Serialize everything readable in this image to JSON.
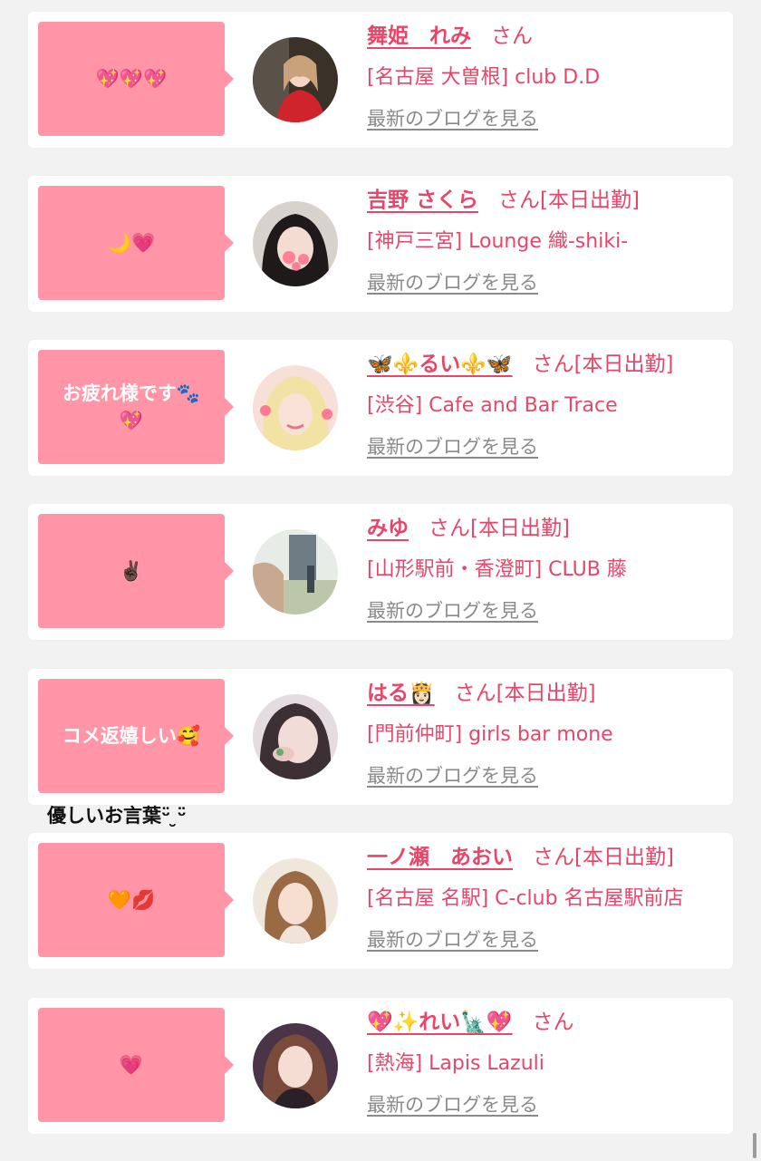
{
  "blog_link_label": "最新のブログを見る",
  "colors": {
    "accent": "#e8456a",
    "bubble": "#ff95a6",
    "link_gray": "#8a8a8a"
  },
  "entries": [
    {
      "comment": "💖💖💖",
      "name": "舞姫　れみ",
      "honorific": "さん",
      "shop": "[名古屋 大曽根] club D.D"
    },
    {
      "comment": "🌙💗",
      "name": "吉野 さくら",
      "honorific": "さん[本日出勤]",
      "shop": "[神戸三宮] Lounge 織-shiki-"
    },
    {
      "comment": "お疲れ様です🐾\n💖",
      "name": "🦋⚜️るい⚜️🦋",
      "honorific": "さん[本日出勤]",
      "shop": "[渋谷] Cafe and Bar Trace"
    },
    {
      "comment": "✌🏿",
      "name": "みゆ",
      "honorific": "さん[本日出勤]",
      "shop": "[山形駅前・香澄町] CLUB 藤"
    },
    {
      "comment": "コメ返嬉しい🥰",
      "comment_overflow": "優しいお言葉ᵕ̈ ̮ᵕ̈",
      "name": "はる👸🏻",
      "honorific": "さん[本日出勤]",
      "shop": "[門前仲町] girls bar mone"
    },
    {
      "comment": "🧡💋",
      "name": "一ノ瀬　あおい",
      "honorific": "さん[本日出勤]",
      "shop": "[名古屋 名駅] C-club 名古屋駅前店"
    },
    {
      "comment": "💗",
      "name": "💖✨れい🗽💖",
      "honorific": "さん",
      "shop": "[熱海] Lapis Lazuli"
    }
  ]
}
